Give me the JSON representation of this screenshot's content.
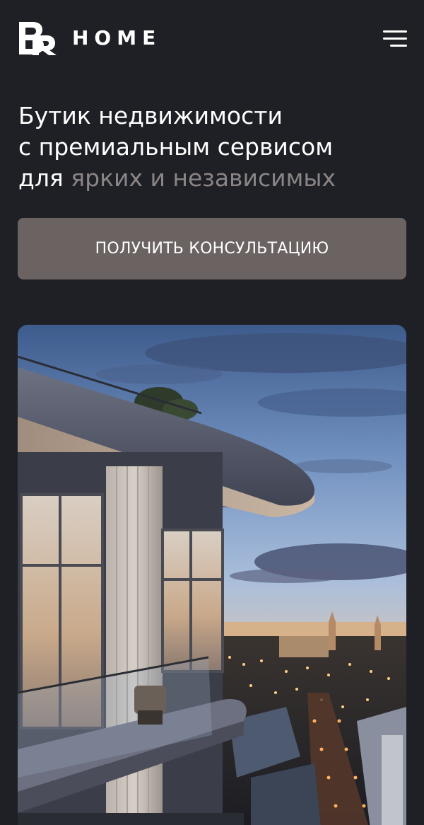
{
  "header": {
    "logo_text": "HOME",
    "logo_mark": "BR",
    "menu_icon": "hamburger-menu-icon"
  },
  "hero": {
    "title_line1": "Бутик недвижимости",
    "title_line2": "с премиальным сервисом",
    "title_line3_prefix": "для",
    "title_line3_accent": "ярких и независимых",
    "accent_color": "#8a8586"
  },
  "cta": {
    "label": "ПОЛУЧИТЬ КОНСУЛЬТАЦИЮ",
    "color": "#6b6362"
  },
  "colors": {
    "background": "#1e2026",
    "text": "#ffffff"
  }
}
